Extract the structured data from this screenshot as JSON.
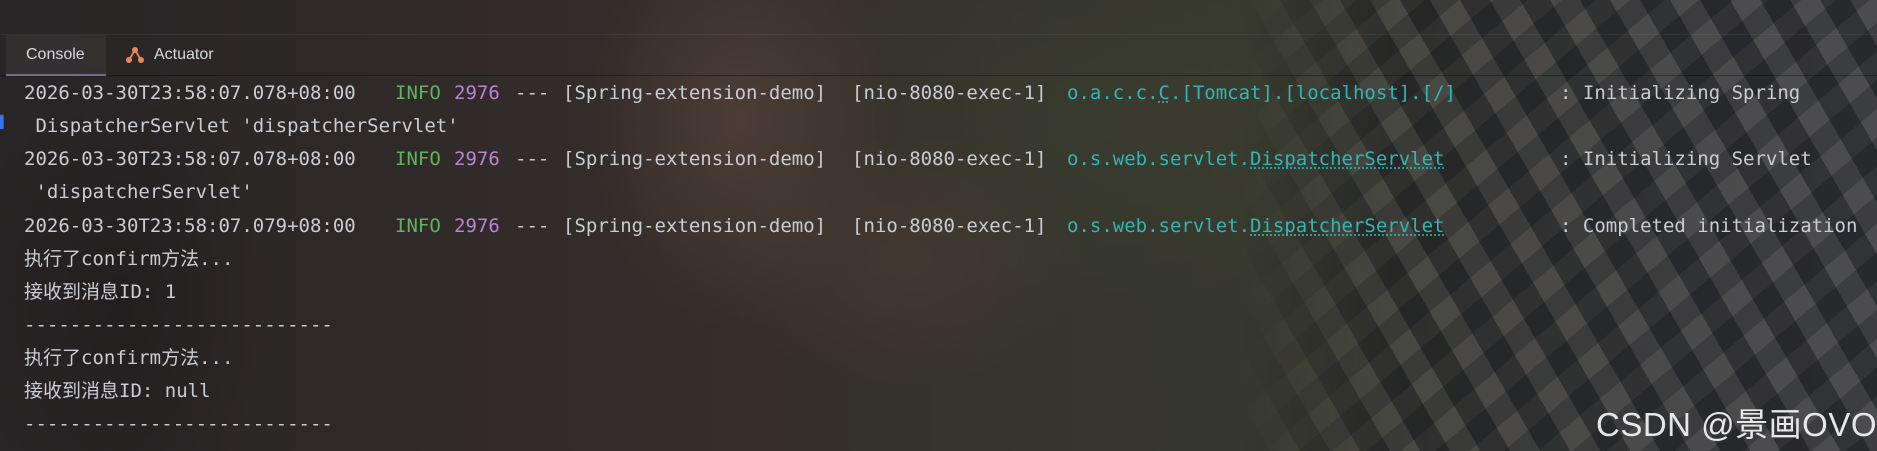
{
  "tabs": [
    {
      "label": "Console",
      "active": true
    },
    {
      "label": "Actuator",
      "icon": "actuator-icon",
      "active": false
    }
  ],
  "log": {
    "entries": [
      {
        "timestamp": "2026-03-30T23:58:07.078+08:00",
        "level": "INFO",
        "pid": "2976",
        "sep": "---",
        "app": "[Spring-extension-demo]",
        "thread": "[nio-8080-exec-1]",
        "logger_prefix": "o.a.c.c.",
        "logger_link": "C",
        "logger_suffix": ".[Tomcat].[localhost].[/]",
        "message": ": Initializing Spring",
        "continuation": " DispatcherServlet 'dispatcherServlet'"
      },
      {
        "timestamp": "2026-03-30T23:58:07.078+08:00",
        "level": "INFO",
        "pid": "2976",
        "sep": "---",
        "app": "[Spring-extension-demo]",
        "thread": "[nio-8080-exec-1]",
        "logger_prefix": "o.s.web.servlet.",
        "logger_link": "DispatcherServlet",
        "message": ": Initializing Servlet",
        "continuation": " 'dispatcherServlet'"
      },
      {
        "timestamp": "2026-03-30T23:58:07.079+08:00",
        "level": "INFO",
        "pid": "2976",
        "sep": "---",
        "app": "[Spring-extension-demo]",
        "thread": "[nio-8080-exec-1]",
        "logger_prefix": "o.s.web.servlet.",
        "logger_link": "DispatcherServlet",
        "message": ": Completed initialization"
      }
    ],
    "plain_lines": [
      "执行了confirm方法...",
      "接收到消息ID: 1",
      "---------------------------",
      "执行了confirm方法...",
      "接收到消息ID: null",
      "---------------------------"
    ]
  },
  "watermark": "CSDN @景画OVO",
  "colors": {
    "info": "#5fb35f",
    "pid": "#b884d6",
    "logger": "#2fb6b6",
    "text": "#c9ccd1"
  }
}
